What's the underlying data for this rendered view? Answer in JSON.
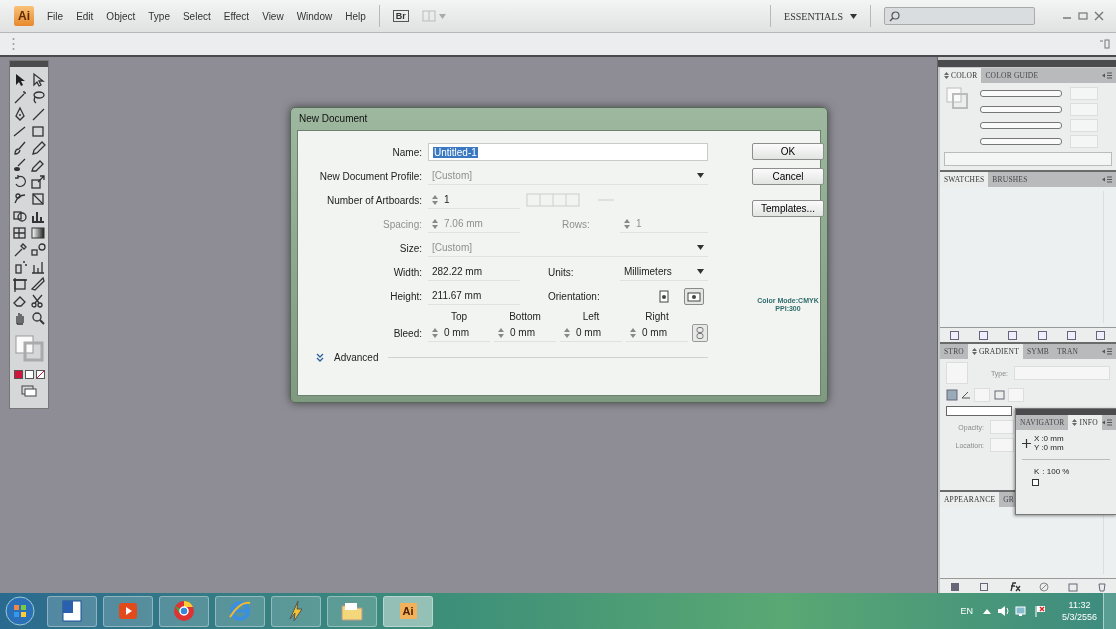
{
  "app": {
    "logo": "Ai",
    "menus": [
      "File",
      "Edit",
      "Object",
      "Type",
      "Select",
      "Effect",
      "View",
      "Window",
      "Help"
    ],
    "bridge": "Br",
    "workspace": "ESSENTIALS"
  },
  "dialog": {
    "title": "New Document",
    "rows": [
      {
        "kind": "text",
        "label": "Name:",
        "value": "Untitled-1",
        "text_selected": true
      },
      {
        "kind": "dropdown",
        "label": "New Document Profile:",
        "value": "[Custom]",
        "disabled": true
      },
      {
        "kind": "spinner",
        "label": "Number of Artboards:",
        "value": "1"
      },
      {
        "kind": "pair",
        "label": "Spacing:",
        "value": "7.06 mm",
        "label2": "Rows:",
        "value2": "1",
        "disabled": true
      },
      {
        "kind": "dropdown",
        "label": "Size:",
        "value": "[Custom]",
        "disabled": true
      },
      {
        "kind": "units",
        "label": "Width:",
        "value": "282.22 mm",
        "label2": "Units:",
        "value2": "Millimeters"
      },
      {
        "kind": "orientation",
        "label": "Height:",
        "value": "211.67 mm",
        "label2": "Orientation:",
        "options": [
          {
            "kind": "portrait",
            "selected": false
          },
          {
            "kind": "landscape",
            "selected": true
          }
        ]
      },
      {
        "kind": "bleed",
        "label": "Bleed:",
        "sides": [
          {
            "heading": "Top",
            "value": "0 mm"
          },
          {
            "heading": "Bottom",
            "value": "0 mm"
          },
          {
            "heading": "Left",
            "value": "0 mm"
          },
          {
            "heading": "Right",
            "value": "0 mm"
          }
        ]
      }
    ],
    "buttons": [
      "OK",
      "Cancel",
      "Templates..."
    ],
    "color_mode": "Color Mode:CMYK",
    "ppi": "PPI:300",
    "advanced": {
      "label": "Advanced",
      "expanded": false
    }
  },
  "panels": {
    "color": {
      "tabs": [
        {
          "label": "COLOR",
          "selected": true,
          "options_toggle": true
        },
        {
          "label": "COLOR GUIDE",
          "selected": false,
          "options_toggle": false
        }
      ]
    },
    "swatches": {
      "tabs": [
        {
          "label": "SWATCHES",
          "selected": true,
          "options_toggle": false
        },
        {
          "label": "BRUSHES",
          "selected": false,
          "options_toggle": false
        }
      ]
    },
    "gradient": {
      "tabs": [
        {
          "label": "STRO",
          "selected": false,
          "options_toggle": false
        },
        {
          "label": "GRADIENT",
          "selected": true,
          "options_toggle": true
        },
        {
          "label": "SYMB",
          "selected": false,
          "options_toggle": false
        },
        {
          "label": "TRAN",
          "selected": false,
          "options_toggle": false
        }
      ],
      "type_label": "Type:",
      "opacity_label": "Opacity:",
      "location_label": "Location:"
    },
    "appearance": {
      "tabs": [
        {
          "label": "APPEARANCE",
          "selected": true,
          "options_toggle": false
        },
        {
          "label": "GR",
          "selected": false,
          "options_toggle": false
        }
      ]
    },
    "info": {
      "tabs": [
        {
          "label": "NAVIGATOR",
          "selected": false,
          "options_toggle": false
        },
        {
          "label": "INFO",
          "selected": true,
          "options_toggle": true
        }
      ],
      "coords": [
        {
          "axis": "X",
          "value": ":0 mm"
        },
        {
          "axis": "Y",
          "value": ":0 mm"
        }
      ],
      "channel": {
        "axis": "K",
        "value": ": 100 %"
      }
    }
  },
  "taskbar": {
    "ai_label": "Ai",
    "language": "EN",
    "time": "11:32",
    "date": "5/3/2556"
  }
}
